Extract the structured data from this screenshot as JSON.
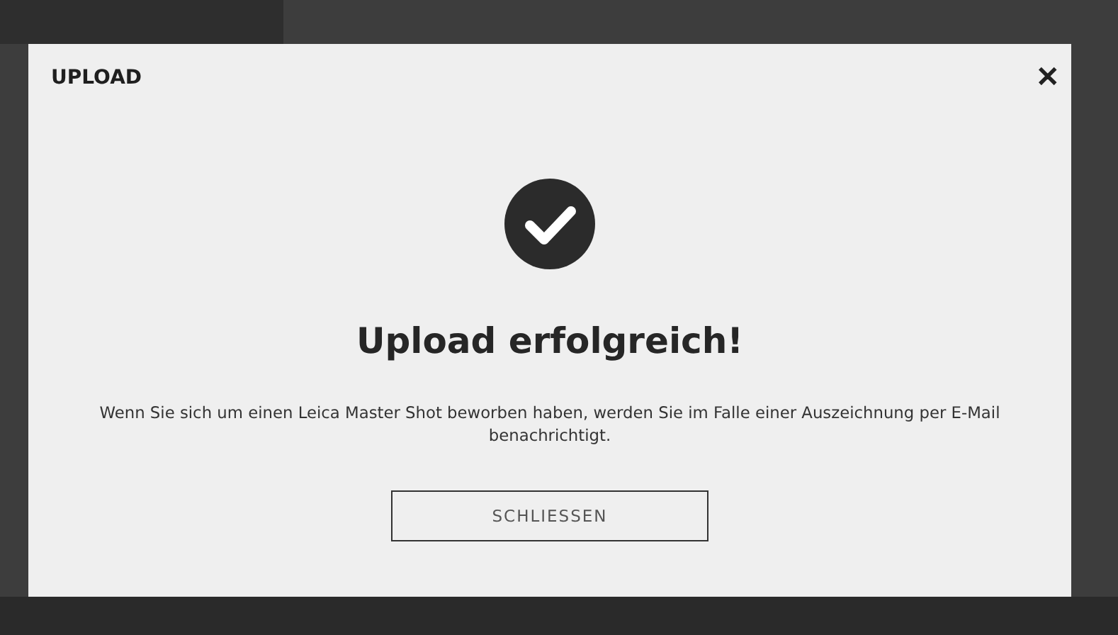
{
  "dialog": {
    "title": "UPLOAD",
    "close_label": "✕",
    "heading": "Upload erfolgreich!",
    "message": "Wenn Sie sich um einen Leica Master Shot beworben haben, werden Sie im Falle einer Auszeichnung per E-Mail benachrichtigt.",
    "button": "SCHLIESSEN"
  }
}
